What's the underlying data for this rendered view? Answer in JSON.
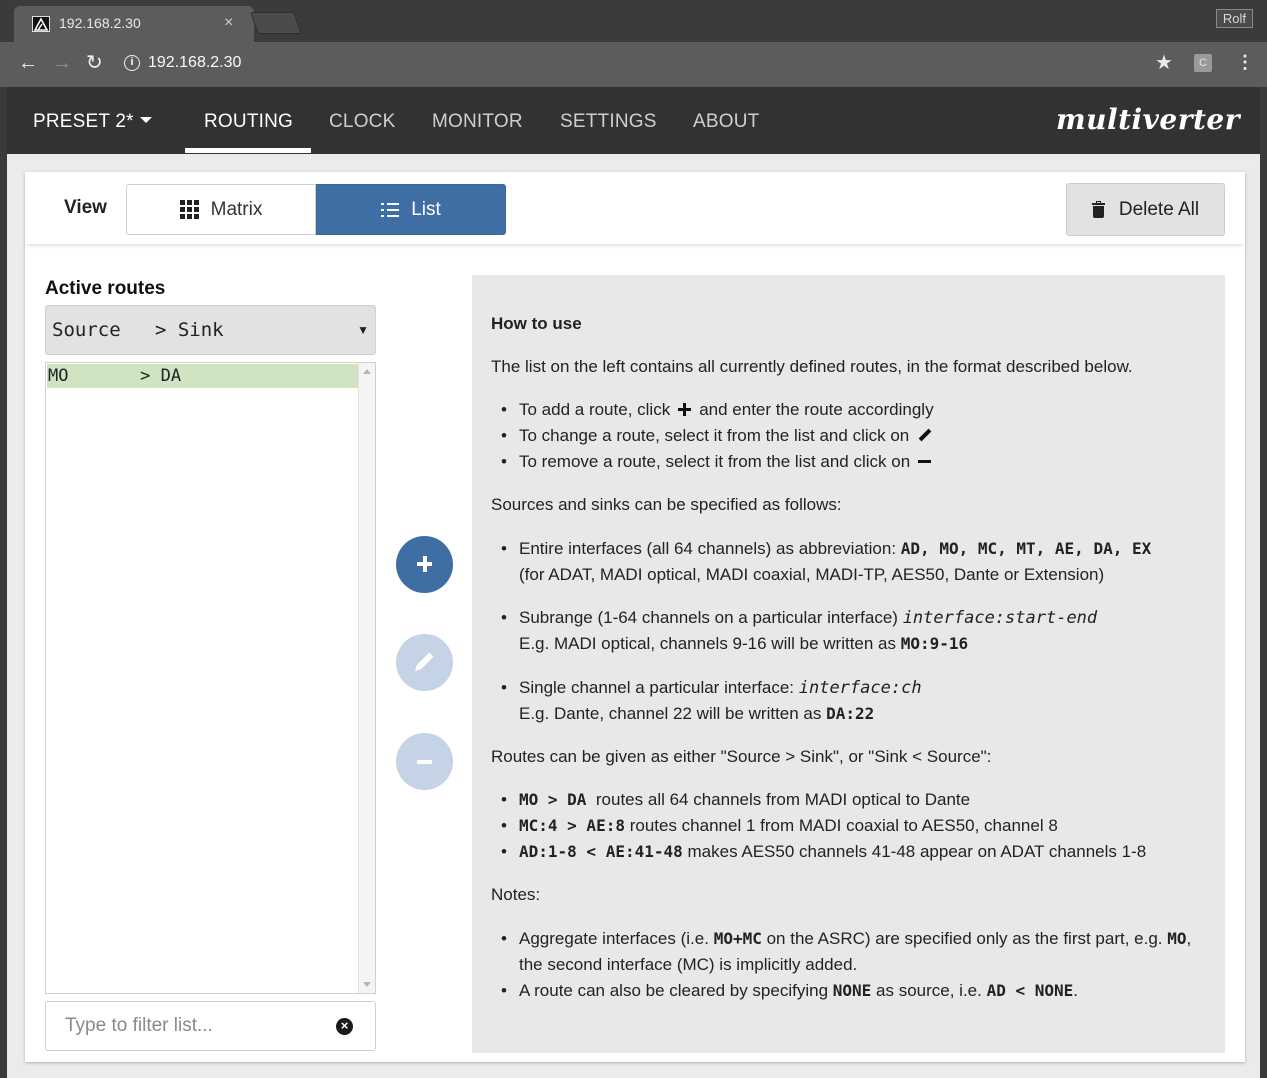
{
  "browser": {
    "tab_title": "192.168.2.30",
    "tab_close": "×",
    "profile": "Rolf",
    "url": "192.168.2.30",
    "extension_label": "C",
    "info_icon": "i"
  },
  "nav": {
    "preset": "PRESET 2*",
    "items": [
      "ROUTING",
      "CLOCK",
      "MONITOR",
      "SETTINGS",
      "ABOUT"
    ],
    "active": "ROUTING",
    "logo": "multiverter"
  },
  "toolbar": {
    "view_label": "View",
    "matrix_label": "Matrix",
    "list_label": "List",
    "delete_all_label": "Delete All",
    "accent_color": "#3f6ea5"
  },
  "routes": {
    "title": "Active routes",
    "select_value": "Source   > Sink",
    "items": [
      "MO       > DA"
    ],
    "selected_color": "#cfe4c3",
    "filter_placeholder": "Type to filter list..."
  },
  "help": {
    "title": "How to use",
    "intro": "The list on the left contains all currently defined routes, in the format described below.",
    "bullets1": {
      "add_a": "To add a route, click",
      "add_b": "and enter the route accordingly",
      "change": "To change a route, select it from the list and click on",
      "remove": "To remove a route, select it from the list and click on"
    },
    "sources_intro": "Sources and sinks can be specified as follows:",
    "entire": {
      "text": "Entire interfaces (all 64 channels) as abbreviation:",
      "codes": "AD, MO, MC, MT, AE, DA, EX",
      "note": "(for ADAT, MADI optical, MADI coaxial, MADI-TP, AES50, Dante or Extension)"
    },
    "subrange": {
      "text": "Subrange (1-64 channels on a particular interface)",
      "format": "interface:start-end",
      "example": "E.g. MADI optical, channels 9-16 will be written as",
      "example_code": "MO:9-16"
    },
    "single": {
      "text": "Single channel a particular interface:",
      "format": "interface:ch",
      "example": "E.g. Dante, channel 22 will be written as",
      "example_code": "DA:22"
    },
    "routes_intro": "Routes can be given as either \"Source > Sink\", or \"Sink < Source\":",
    "examples": [
      {
        "code": "MO > DA",
        "text": "routes all 64 channels from MADI optical to Dante"
      },
      {
        "code": "MC:4 > AE:8",
        "text": "routes channel 1 from MADI coaxial to AES50, channel 8"
      },
      {
        "code": "AD:1-8 < AE:41-48",
        "text": "makes AES50 channels 41-48 appear on ADAT channels 1-8"
      }
    ],
    "notes_title": "Notes:",
    "note1": {
      "a": "Aggregate interfaces (i.e.",
      "code1": "MO+MC",
      "b": "on the ASRC) are specified only as the first part, e.g.",
      "code2": "MO",
      "c": ",",
      "line2": "the second interface (MC) is implicitly added."
    },
    "note2": {
      "a": "A route can also be cleared by specifying",
      "code1": "NONE",
      "b": "as source, i.e.",
      "code2": "AD < NONE",
      "c": "."
    }
  }
}
